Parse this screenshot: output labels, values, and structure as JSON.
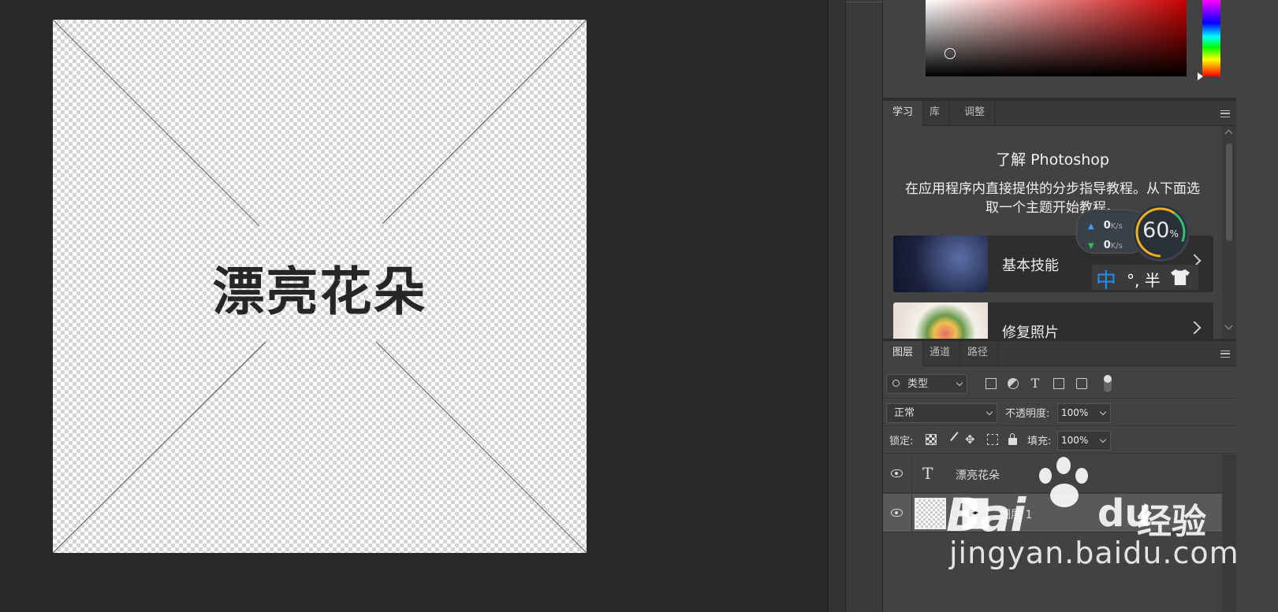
{
  "canvas": {
    "text": "漂亮花朵"
  },
  "learn_panel": {
    "tabs": [
      "学习",
      "库",
      "调整"
    ],
    "title": "了解 Photoshop",
    "description": "在应用程序内直接提供的分步指导教程。从下面选取一个主题开始教程。",
    "cards": [
      {
        "label": "基本技能"
      },
      {
        "label": "修复照片"
      }
    ]
  },
  "layers_panel": {
    "tabs": [
      "图层",
      "通道",
      "路径"
    ],
    "filter": {
      "value": "类型",
      "icon": "search-icon"
    },
    "blend_mode": "正常",
    "opacity_label": "不透明度:",
    "opacity_value": "100%",
    "lock_label": "锁定:",
    "fill_label": "填充:",
    "fill_value": "100%",
    "layers": [
      {
        "name": "漂亮花朵",
        "type": "text"
      },
      {
        "name": "图层 1",
        "type": "pixel",
        "selected": true
      }
    ]
  },
  "overlay_widget": {
    "upload_speed": "0",
    "download_speed": "0",
    "speed_unit": "K/s",
    "gauge_value": "60",
    "gauge_unit": "%",
    "ime_mode": "中",
    "ime_punct": "°, 半"
  },
  "watermark": {
    "brand_left": "Bai",
    "brand_right": "du",
    "brand_cn": "经验",
    "url": "jingyan.baidu.com"
  },
  "colors": {
    "app_bg": "#282828",
    "panel_bg": "#424242",
    "selected_layer": "#595959",
    "picker_hue": "#c90000"
  }
}
